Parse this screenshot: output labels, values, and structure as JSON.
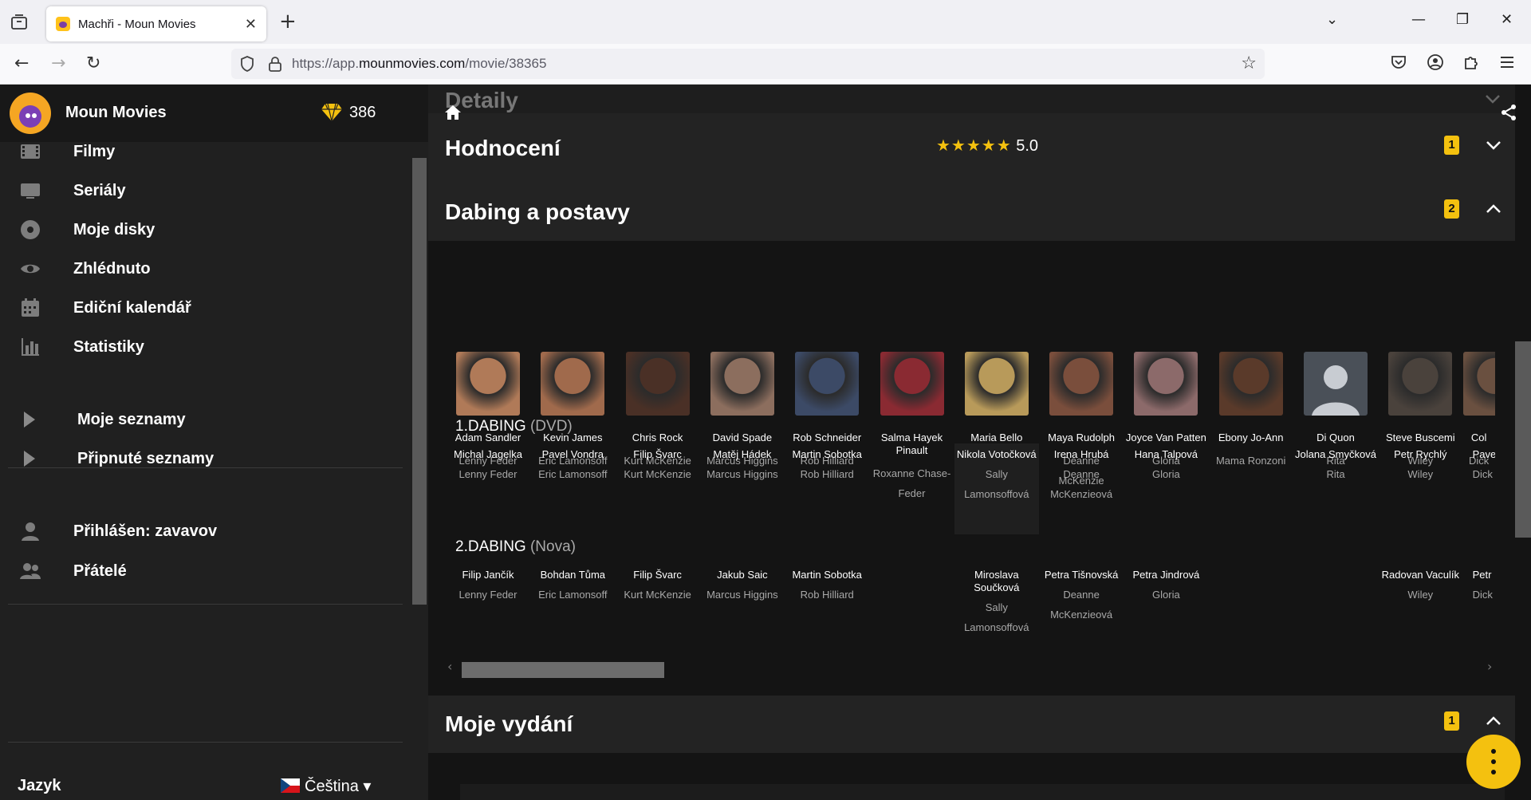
{
  "browser": {
    "tab_title": "Machři - Moun Movies",
    "url_prefix": "https://app.",
    "url_domain": "mounmovies.com",
    "url_path": "/movie/38365"
  },
  "sidebar": {
    "app_name": "Moun Movies",
    "gems": "386",
    "items": [
      {
        "label": "Filmy",
        "icon": "film-icon"
      },
      {
        "label": "Seriály",
        "icon": "tv-icon"
      },
      {
        "label": "Moje disky",
        "icon": "disc-icon"
      },
      {
        "label": "Zhlédnuto",
        "icon": "eye-icon"
      },
      {
        "label": "Ediční kalendář",
        "icon": "calendar-icon"
      },
      {
        "label": "Statistiky",
        "icon": "bar-chart-icon"
      }
    ],
    "lists": [
      {
        "label": "Moje seznamy"
      },
      {
        "label": "Připnuté seznamy"
      }
    ],
    "user": {
      "label": "Přihlášen: zavavov",
      "icon": "user-icon"
    },
    "friends": {
      "label": "Přátelé",
      "icon": "users-icon"
    },
    "language_label": "Jazyk",
    "language_value": "Čeština"
  },
  "main": {
    "details_title": "Detaily",
    "rating_title": "Hodnocení",
    "rating_stars": "★★★★★",
    "rating_value": "5.0",
    "rating_badge": "1",
    "cast_title": "Dabing a postavy",
    "cast_badge": "2",
    "editions_title": "Moje vydání",
    "editions_badge": "1",
    "cast": [
      {
        "name": "Adam Sandler",
        "role": "Lenny Feder",
        "photo": "#b07a58"
      },
      {
        "name": "Kevin James",
        "role": "Eric Lamonsoff",
        "photo": "#a06a4c"
      },
      {
        "name": "Chris Rock",
        "role": "Kurt McKenzie",
        "photo": "#4a3026"
      },
      {
        "name": "David Spade",
        "role": "Marcus Higgins",
        "photo": "#8c6e5e"
      },
      {
        "name": "Rob Schneider",
        "role": "Rob Hilliard",
        "photo": "#3c4a66"
      },
      {
        "name": "Salma Hayek Pinault",
        "role": "Roxanne Chase-Feder",
        "photo": "#8a2a32"
      },
      {
        "name": "Maria Bello",
        "role": "Sally Lamonsoff",
        "photo": "#b89a5a"
      },
      {
        "name": "Maya Rudolph",
        "role": "Deanne McKenzie",
        "photo": "#7a4e3c"
      },
      {
        "name": "Joyce Van Patten",
        "role": "Gloria",
        "photo": "#8c6a6a"
      },
      {
        "name": "Ebony Jo-Ann",
        "role": "Mama Ronzoni",
        "photo": "#5a3a2a"
      },
      {
        "name": "Di Quon",
        "role": "Rita",
        "photo": "#3a4450"
      },
      {
        "name": "Steve Buscemi",
        "role": "Wiley",
        "photo": "#4a423c"
      },
      {
        "name": "Col",
        "role": "Dick",
        "photo": "#6a5040"
      }
    ],
    "dub1": {
      "label": "1.DABING",
      "source": "(DVD)",
      "entries": [
        {
          "name": "Michal Jagelka",
          "role": "Lenny Feder"
        },
        {
          "name": "Pavel Vondra",
          "role": "Eric Lamonsoff"
        },
        {
          "name": "Filip Švarc",
          "role": "Kurt McKenzie"
        },
        {
          "name": "Matěj Hádek",
          "role": "Marcus Higgins"
        },
        {
          "name": "Martin Sobotka",
          "role": "Rob Hilliard"
        },
        {
          "name": "",
          "role": ""
        },
        {
          "name": "Nikola Votočková",
          "role": "Sally Lamonsoffová"
        },
        {
          "name": "Irena Hrubá",
          "role": "Deanne McKenzieová"
        },
        {
          "name": "Hana Talpová",
          "role": "Gloria"
        },
        {
          "name": "",
          "role": ""
        },
        {
          "name": "Jolana Smyčková",
          "role": "Rita"
        },
        {
          "name": "Petr Rychlý",
          "role": "Wiley"
        },
        {
          "name": "Pave",
          "role": "Dick"
        }
      ]
    },
    "dub2": {
      "label": "2.DABING",
      "source": "(Nova)",
      "entries": [
        {
          "name": "Filip Jančík",
          "role": "Lenny Feder"
        },
        {
          "name": "Bohdan Tůma",
          "role": "Eric Lamonsoff"
        },
        {
          "name": "Filip Švarc",
          "role": "Kurt McKenzie"
        },
        {
          "name": "Jakub Saic",
          "role": "Marcus Higgins"
        },
        {
          "name": "Martin Sobotka",
          "role": "Rob Hilliard"
        },
        {
          "name": "",
          "role": ""
        },
        {
          "name": "Miroslava Součková",
          "role": "Sally Lamonsoffová"
        },
        {
          "name": "Petra Tišnovská",
          "role": "Deanne McKenzieová"
        },
        {
          "name": "Petra Jindrová",
          "role": "Gloria"
        },
        {
          "name": "",
          "role": ""
        },
        {
          "name": "",
          "role": ""
        },
        {
          "name": "Radovan Vaculík",
          "role": "Wiley"
        },
        {
          "name": "Petr",
          "role": "Dick"
        }
      ]
    }
  },
  "colors": {
    "accent": "#f4c10f",
    "sidebar_bg": "#202020",
    "main_bg": "#141414",
    "panel_bg": "#232323"
  }
}
